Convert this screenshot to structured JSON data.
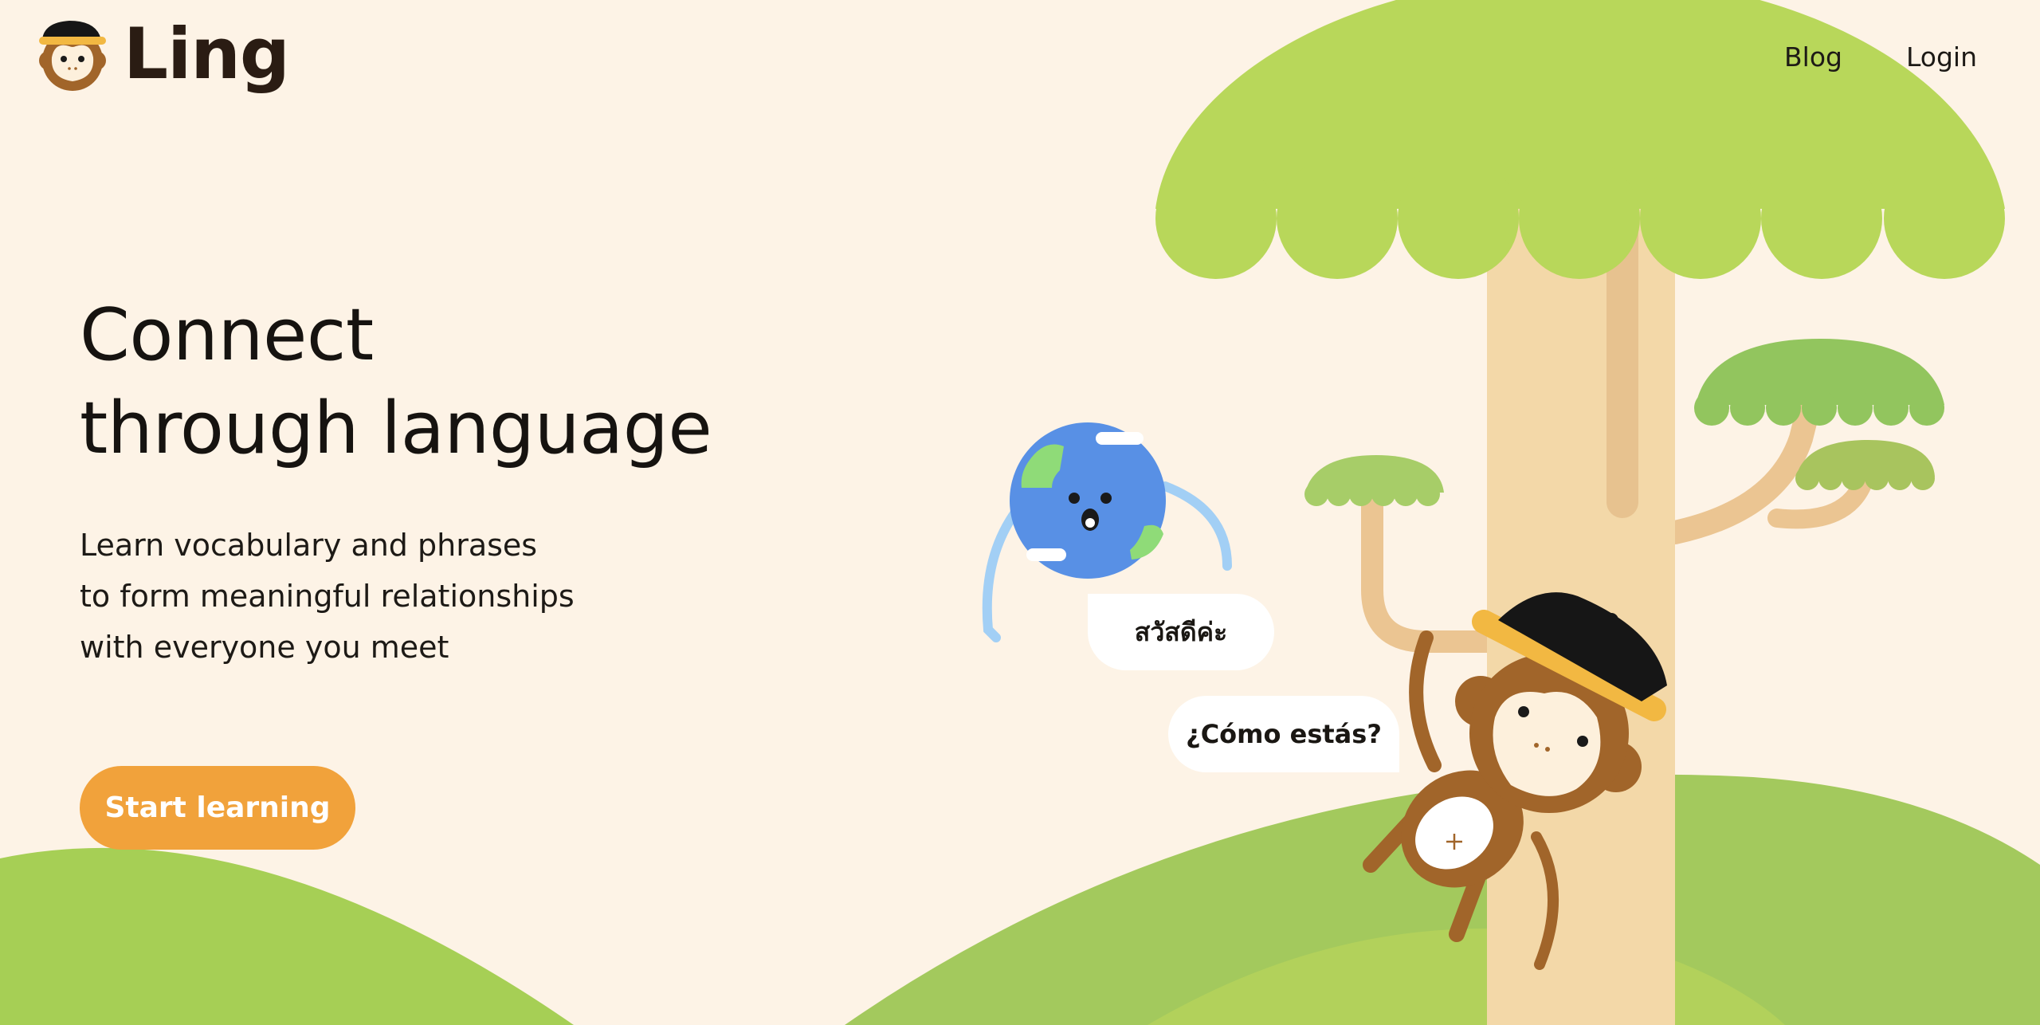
{
  "brand": {
    "name": "Ling",
    "logo_icon": "monkey-mascot-icon"
  },
  "nav": {
    "blog": "Blog",
    "login": "Login"
  },
  "hero": {
    "title_line1": "Connect",
    "title_line2": "through language",
    "subtitle_line1": "Learn vocabulary and phrases",
    "subtitle_line2": "to form meaningful relationships",
    "subtitle_line3": "with everyone you meet",
    "cta_label": "Start learning"
  },
  "illustration": {
    "bubble_thai": "สวัสดีค่ะ",
    "bubble_spanish": "¿Cómo estás?"
  },
  "colors": {
    "background": "#fdf3e6",
    "accent_orange": "#f1a23b",
    "canopy_green": "#b8d75a",
    "hill_green": "#9fc95a",
    "trunk": "#f3d8a8",
    "globe_blue": "#5890e5",
    "monkey_brown": "#a1652a"
  }
}
